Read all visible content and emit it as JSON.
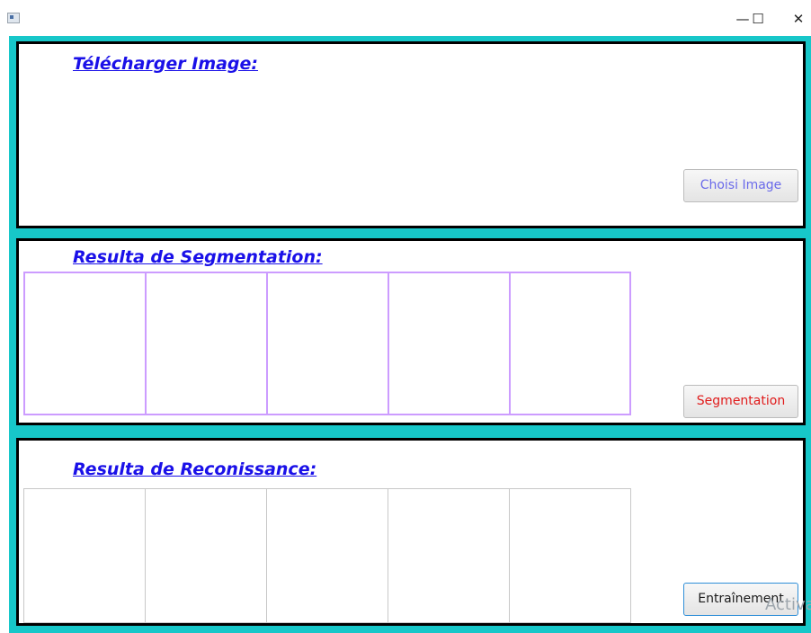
{
  "window": {
    "minimize_glyph": "—",
    "maximize_glyph": "☐",
    "close_glyph": "✕"
  },
  "panels": {
    "upload": {
      "heading": "Télécharger Image:",
      "button": {
        "label": "Choisi Image",
        "text_color": "#6a6aea"
      }
    },
    "segmentation": {
      "heading": "Resulta de Segmentation:",
      "button": {
        "label": "Segmentation",
        "text_color": "#e01b1b"
      },
      "cell_count": 5
    },
    "recognition": {
      "heading": "Resulta de Reconissance:",
      "button": {
        "label": "Entraînement",
        "text_color": "#1b1b1b"
      },
      "cell_count": 5
    }
  },
  "colors": {
    "background": "#17c7c9",
    "heading": "#1a10e8",
    "panel_border": "#000000",
    "segment_cell_border": "#cc9cff"
  },
  "watermark": "Activa"
}
